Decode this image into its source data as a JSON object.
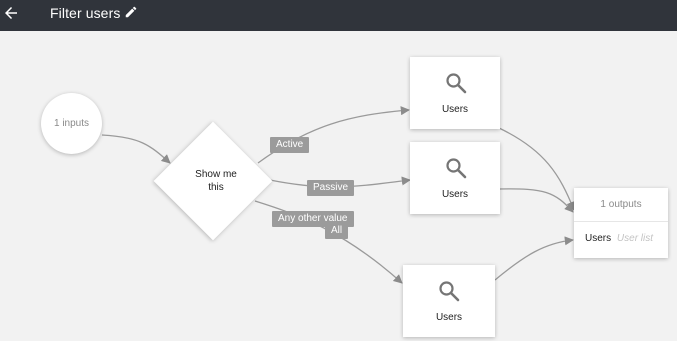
{
  "header": {
    "title": "Filter users"
  },
  "icons": {
    "back": "arrow-back-icon",
    "edit": "pencil-icon",
    "search": "search-icon"
  },
  "input_node": {
    "label": "1 inputs"
  },
  "decision_node": {
    "label": "Show me this"
  },
  "edge_labels": {
    "active": "Active",
    "passive": "Passive",
    "other": "Any other value",
    "all": "All"
  },
  "cards": [
    {
      "label": "Users"
    },
    {
      "label": "Users"
    },
    {
      "label": "Users"
    }
  ],
  "output_node": {
    "header": "1 outputs",
    "row": {
      "name": "Users",
      "type": "User list"
    }
  },
  "colors": {
    "topbar": "#30343b",
    "canvas": "#f2f2f2",
    "edge": "#9a9a9a",
    "edge_label": "#9b9b9b"
  }
}
